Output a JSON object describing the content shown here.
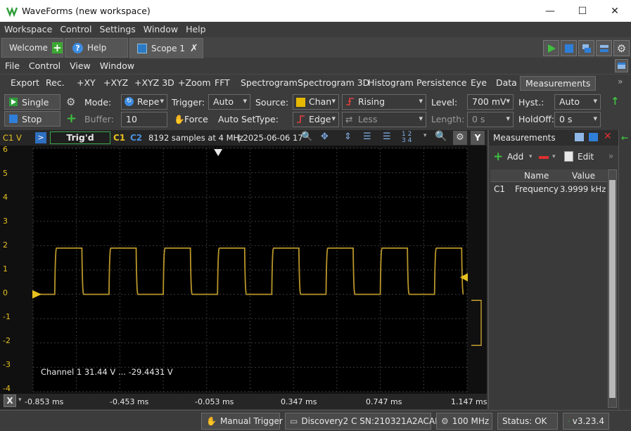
{
  "window": {
    "title": "WaveForms (new workspace)"
  },
  "menu": [
    "Workspace",
    "Control",
    "Settings",
    "Window",
    "Help"
  ],
  "tabs": {
    "welcome": "Welcome",
    "help": "Help",
    "scope": "Scope 1"
  },
  "scope_menu": [
    "File",
    "Control",
    "View",
    "Window"
  ],
  "toolbar": {
    "export": "Export",
    "rec": "Rec.",
    "xy": "+XY",
    "xyz": "+XYZ",
    "xyz3d": "+XYZ 3D",
    "zoom": "+Zoom",
    "fft": "FFT",
    "spectrogram": "Spectrogram",
    "spectrogram3d": "Spectrogram 3D",
    "histogram": "Histogram",
    "persistence": "Persistence",
    "eye": "Eye",
    "data": "Data",
    "measurements": "Measurements"
  },
  "controls": {
    "single": "Single",
    "stop": "Stop",
    "mode_label": "Mode:",
    "mode_value": "Repe",
    "buffer_label": "Buffer:",
    "buffer_value": "10",
    "trigger_label": "Trigger:",
    "trigger_value": "Auto",
    "force": "Force",
    "autoset": "Auto Set",
    "source_label": "Source:",
    "source_value": "Chan",
    "type_label": "Type:",
    "type_value": "Edge",
    "edge_value": "Rising",
    "cond_value": "Less",
    "level_label": "Level:",
    "level_value": "700 mV",
    "length_label": "Length:",
    "length_value": "0 s",
    "hyst_label": "Hyst.:",
    "hyst_value": "Auto",
    "holdoff_label": "HoldOff:",
    "holdoff_value": "0 s"
  },
  "plot": {
    "channel_label": "C1 V",
    "status": "Trig'd",
    "c1": "C1",
    "c2": "C2",
    "info": "8192 samples at 4 MHz",
    "date": "| 2025-06-06 17",
    "y_ticks": [
      "6",
      "5",
      "4",
      "3",
      "2",
      "1",
      "0",
      "-1",
      "-2",
      "-3",
      "-4"
    ],
    "x_ticks": [
      "-0.853 ms",
      "-0.453 ms",
      "-0.053 ms",
      "0.347 ms",
      "0.747 ms",
      "1.147 ms"
    ],
    "readout": "Channel 1  31.44 V ... -29.4431 V",
    "x_button": "X",
    "y_button": "Y",
    "trace_color": "#b8962a"
  },
  "chart_data": {
    "type": "line",
    "x_range_ms": [
      -0.853,
      1.147
    ],
    "ylim": [
      -4,
      6
    ],
    "series": [
      {
        "waveform": "square",
        "frequency_khz": 4,
        "low_v": 0,
        "high_v": 1.9,
        "first_rise_ms": -0.753
      }
    ]
  },
  "measurements": {
    "title": "Measurements",
    "add": "Add",
    "edit": "Edit",
    "columns": [
      "Name",
      "Value"
    ],
    "rows": [
      {
        "channel": "C1",
        "name": "Frequency",
        "value": "3.9999 kHz"
      }
    ]
  },
  "status": {
    "manual_trigger": "Manual Trigger",
    "device": "Discovery2 C SN:210321A2ACAD",
    "clock": "100 MHz",
    "status": "Status: OK",
    "version": "v3.23.4"
  }
}
